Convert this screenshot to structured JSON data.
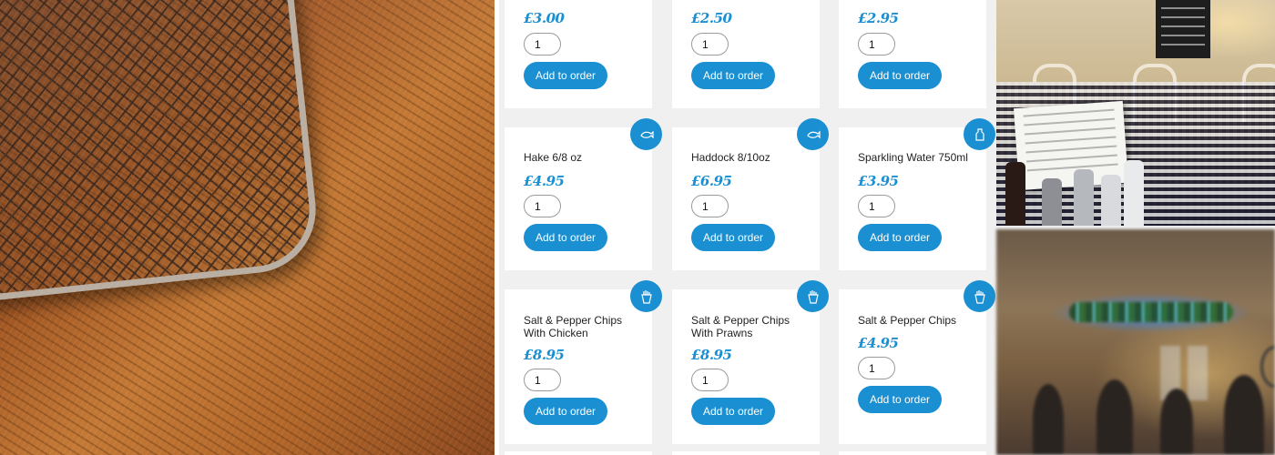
{
  "colors": {
    "accent": "#1a8fd1",
    "card_bg": "#ffffff",
    "page_bg": "#f0f0f0"
  },
  "products": [
    {
      "name": "",
      "price": "£3.00",
      "quantity": "1",
      "button_label": "Add to order",
      "icon": ""
    },
    {
      "name": "",
      "price": "£2.50",
      "quantity": "1",
      "button_label": "Add to order",
      "icon": ""
    },
    {
      "name": "",
      "price": "£2.95",
      "quantity": "1",
      "button_label": "Add to order",
      "icon": ""
    },
    {
      "name": "Hake 6/8 oz",
      "price": "£4.95",
      "quantity": "1",
      "button_label": "Add to order",
      "icon": "fish-icon"
    },
    {
      "name": "Haddock 8/10oz",
      "price": "£6.95",
      "quantity": "1",
      "button_label": "Add to order",
      "icon": "fish-icon"
    },
    {
      "name": "Sparkling Water 750ml",
      "price": "£3.95",
      "quantity": "1",
      "button_label": "Add to order",
      "icon": "bottle-icon"
    },
    {
      "name": "Salt & Pepper Chips With Chicken",
      "price": "£8.95",
      "quantity": "1",
      "button_label": "Add to order",
      "icon": "chips-icon"
    },
    {
      "name": "Salt & Pepper Chips With Prawns",
      "price": "£8.95",
      "quantity": "1",
      "button_label": "Add to order",
      "icon": "chips-icon"
    },
    {
      "name": "Salt & Pepper Chips",
      "price": "£4.95",
      "quantity": "1",
      "button_label": "Add to order",
      "icon": "chips-icon"
    }
  ],
  "photos": {
    "left": "wire-basket-on-wood-photo",
    "right_top": "restaurant-interior-tables-photo",
    "right_bottom": "restaurant-dining-room-photo"
  }
}
